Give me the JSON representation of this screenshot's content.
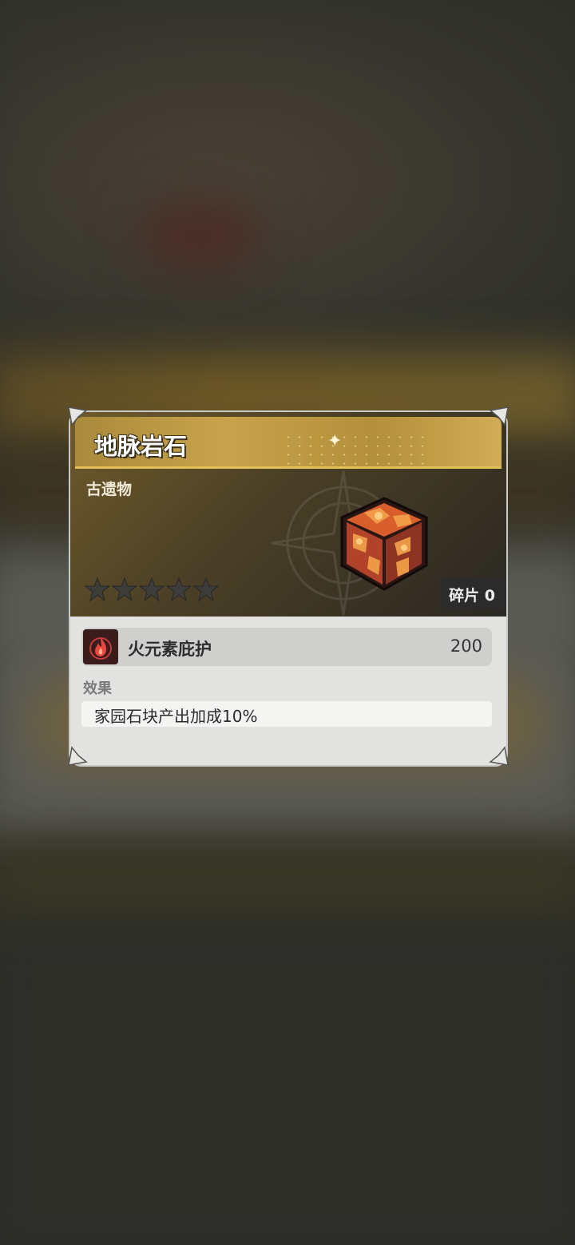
{
  "item": {
    "name": "地脉岩石",
    "category": "古遗物",
    "stars_total": 5,
    "stars_filled": 0,
    "fragments_label": "碎片 0"
  },
  "attribute": {
    "icon": "fire-element-icon",
    "name": "火元素庇护",
    "value": "200"
  },
  "effect": {
    "label": "效果",
    "text": "家园石块产出加成10%"
  },
  "colors": {
    "accent_gold": "#c8a34a",
    "star_empty": "#3c3c3a",
    "fire_icon_bg": "#3b1c1c"
  }
}
